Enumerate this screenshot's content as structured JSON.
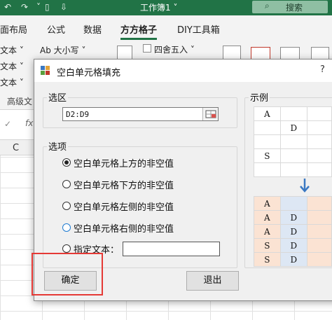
{
  "excel": {
    "title": "工作簿1 ˅",
    "search_label": "搜索",
    "tabs": [
      "面布局",
      "公式",
      "数据",
      "方方格子",
      "DIY工具箱"
    ],
    "active_tab": "方方格子",
    "ribbon": {
      "row1_left": "文本 ˅",
      "row2_left": "文本 ˅",
      "row3_left": "文本 ˅",
      "font_size_label": "Ab 大小写 ˅",
      "round_label": "四舍五入 ˅",
      "group_label": "高级文"
    },
    "column_header": "C",
    "fx_label": "fx"
  },
  "dialog": {
    "title": "空白单元格填充",
    "help": "?",
    "range_group_label": "选区",
    "range_value": "D2:D9",
    "options_group_label": "选项",
    "options": [
      {
        "label": "空白单元格上方的非空值",
        "checked": true
      },
      {
        "label": "空白单元格下方的非空值",
        "checked": false
      },
      {
        "label": "空白单元格左侧的非空值",
        "checked": false
      },
      {
        "label": "空白单元格右侧的非空值",
        "checked": false
      }
    ],
    "custom_text_label": "指定文本：",
    "custom_text_value": "",
    "ok_label": "确定",
    "exit_label": "退出",
    "example_label": "示例",
    "example_before": [
      [
        "A",
        "",
        ""
      ],
      [
        "",
        "D",
        ""
      ],
      [
        "",
        "",
        ""
      ],
      [
        "S",
        "",
        ""
      ],
      [
        "",
        "",
        ""
      ]
    ],
    "example_after": [
      [
        "A",
        "",
        ""
      ],
      [
        "A",
        "D",
        ""
      ],
      [
        "A",
        "D",
        ""
      ],
      [
        "S",
        "D",
        ""
      ],
      [
        "S",
        "D",
        ""
      ]
    ],
    "colors": {
      "after_col_a": "#fbe3d3",
      "after_col_d": "#dde7f4",
      "arrow": "#3a78c2",
      "highlight": "#e53935"
    }
  }
}
